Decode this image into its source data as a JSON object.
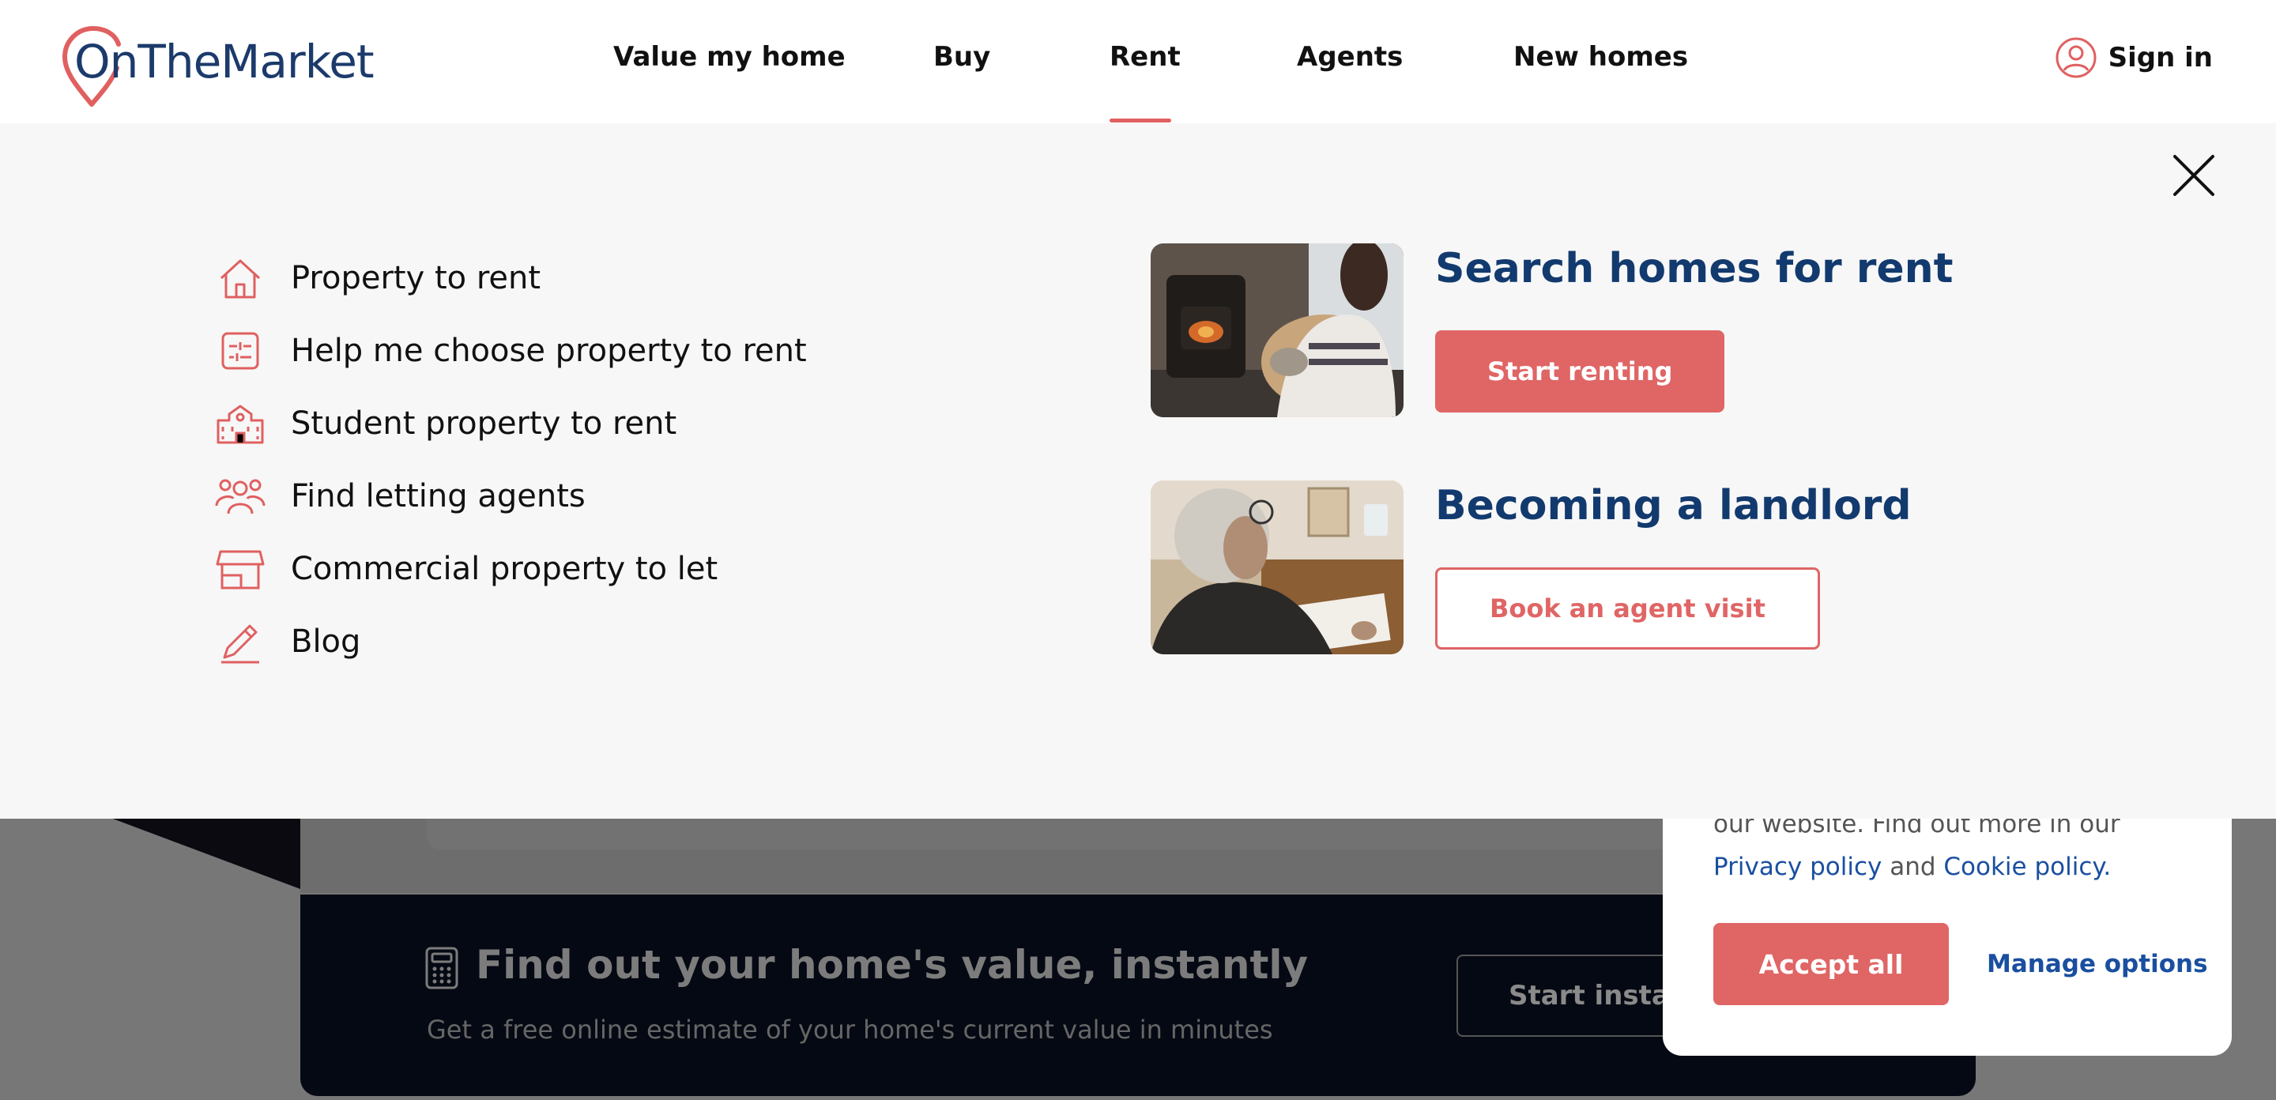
{
  "brand": {
    "name": "OnTheMarket",
    "color": "#1c3a6b",
    "accent": "#e06060"
  },
  "nav": {
    "items": [
      {
        "label": "Value my home"
      },
      {
        "label": "Buy"
      },
      {
        "label": "Rent",
        "active": true
      },
      {
        "label": "Agents"
      },
      {
        "label": "New homes"
      }
    ],
    "signin_label": "Sign in"
  },
  "rent_menu": {
    "links": [
      {
        "label": "Property to rent",
        "icon": "house-icon"
      },
      {
        "label": "Help me choose property to rent",
        "icon": "filter-sliders-icon"
      },
      {
        "label": "Student property to rent",
        "icon": "school-building-icon"
      },
      {
        "label": "Find letting agents",
        "icon": "people-icon"
      },
      {
        "label": "Commercial property to let",
        "icon": "shopfront-icon"
      },
      {
        "label": "Blog",
        "icon": "pencil-icon"
      }
    ],
    "promos": [
      {
        "title": "Search homes for rent",
        "button": "Start renting",
        "image": "woman-by-wood-stove-photo"
      },
      {
        "title": "Becoming a landlord",
        "button": "Book an agent visit",
        "image": "man-writing-at-desk-photo"
      }
    ]
  },
  "background": {
    "value_title": "Find out your home's value, instantly",
    "value_subtitle": "Get a free online estimate of your home's current value in minutes",
    "value_button": "Start instant"
  },
  "cookie": {
    "text_line": "our website. Find out more in our",
    "privacy_link": "Privacy policy",
    "and": "and",
    "cookie_link": "Cookie policy.",
    "accept_label": "Accept all",
    "manage_label": "Manage options"
  }
}
